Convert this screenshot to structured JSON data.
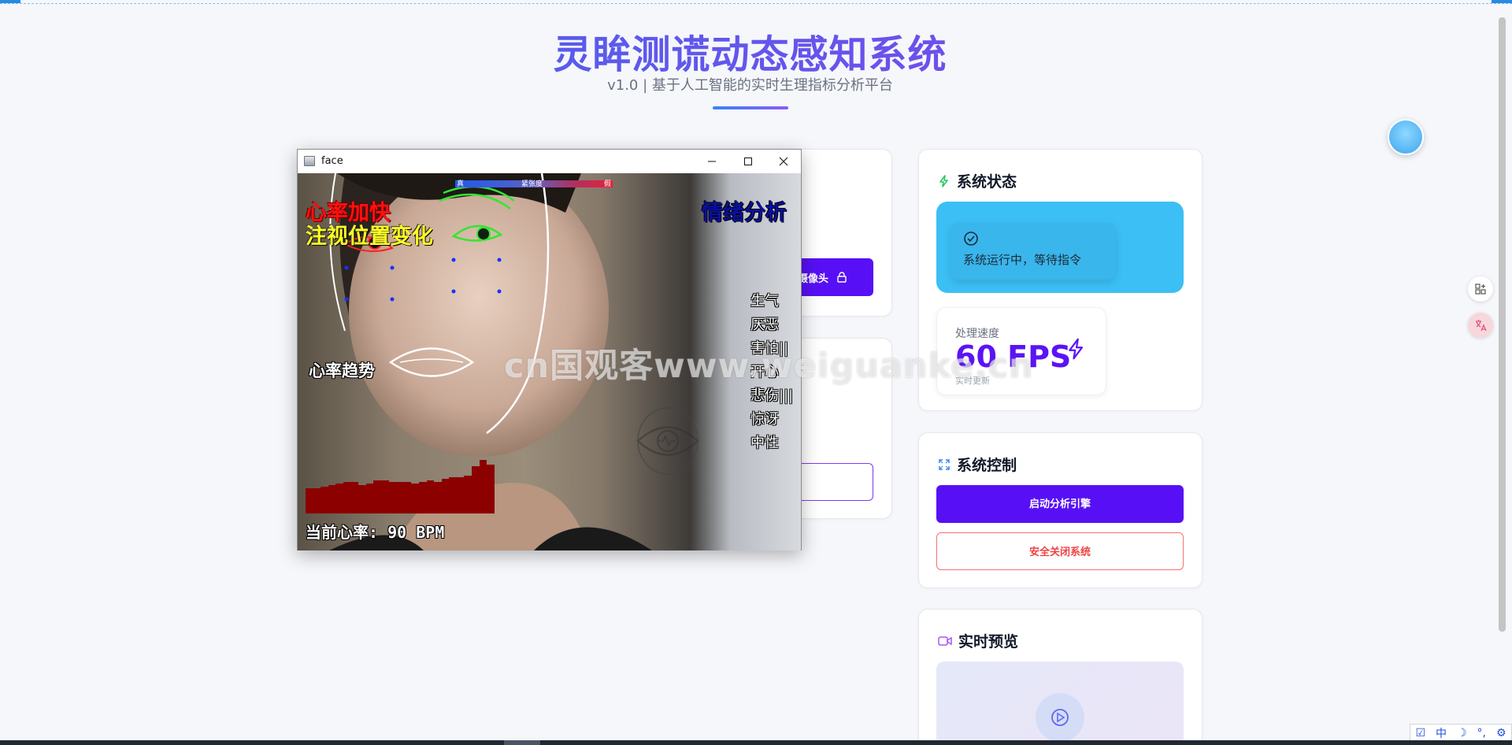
{
  "header": {
    "title": "灵眸测谎动态感知系统",
    "subtitle": "v1.0 | 基于人工智能的实时生理指标分析平台"
  },
  "status_card": {
    "title": "系统状态",
    "message": "系统运行中，等待指令",
    "speed_label": "处理速度",
    "speed_value": "60 FPS",
    "speed_note": "实时更新"
  },
  "control_card": {
    "title": "系统控制",
    "start_label": "启动分析引擎",
    "shutdown_label": "安全关闭系统"
  },
  "preview_card": {
    "title": "实时预览"
  },
  "left_panel": {
    "camera_button_fragment": "摄像头"
  },
  "face_window": {
    "title": "face",
    "overlay": {
      "heart_rate_alert": "心率加快",
      "gaze_alert": "注视位置变化",
      "emotion_title": "情绪分析",
      "trend_label": "心率趋势",
      "current_hr": "当前心率: 90 BPM",
      "meter_left": "真",
      "meter_mid": "紧张度",
      "meter_right": "假"
    },
    "emotions": [
      "生气",
      "厌恶",
      "害怕||",
      "开心",
      "悲伤|||",
      "惊讶",
      "中性"
    ],
    "hr_trend": [
      0.4,
      0.4,
      0.42,
      0.45,
      0.48,
      0.5,
      0.5,
      0.45,
      0.48,
      0.52,
      0.52,
      0.5,
      0.5,
      0.5,
      0.48,
      0.5,
      0.52,
      0.5,
      0.55,
      0.58,
      0.58,
      0.6,
      0.75,
      0.85,
      0.78
    ]
  },
  "watermark": "cn国观客www.weiguanke.cn",
  "ime": {
    "lang": "中"
  },
  "colors": {
    "accent": "#5710f5",
    "status_bg": "#3cbff5",
    "danger": "#ef4444",
    "title_from": "#3b6cf0",
    "title_to": "#8b3fe8"
  },
  "icons": {
    "status": "bolt-icon",
    "control": "expand-icon",
    "preview": "video-icon",
    "check": "check-circle-icon",
    "play": "play-circle-icon"
  }
}
